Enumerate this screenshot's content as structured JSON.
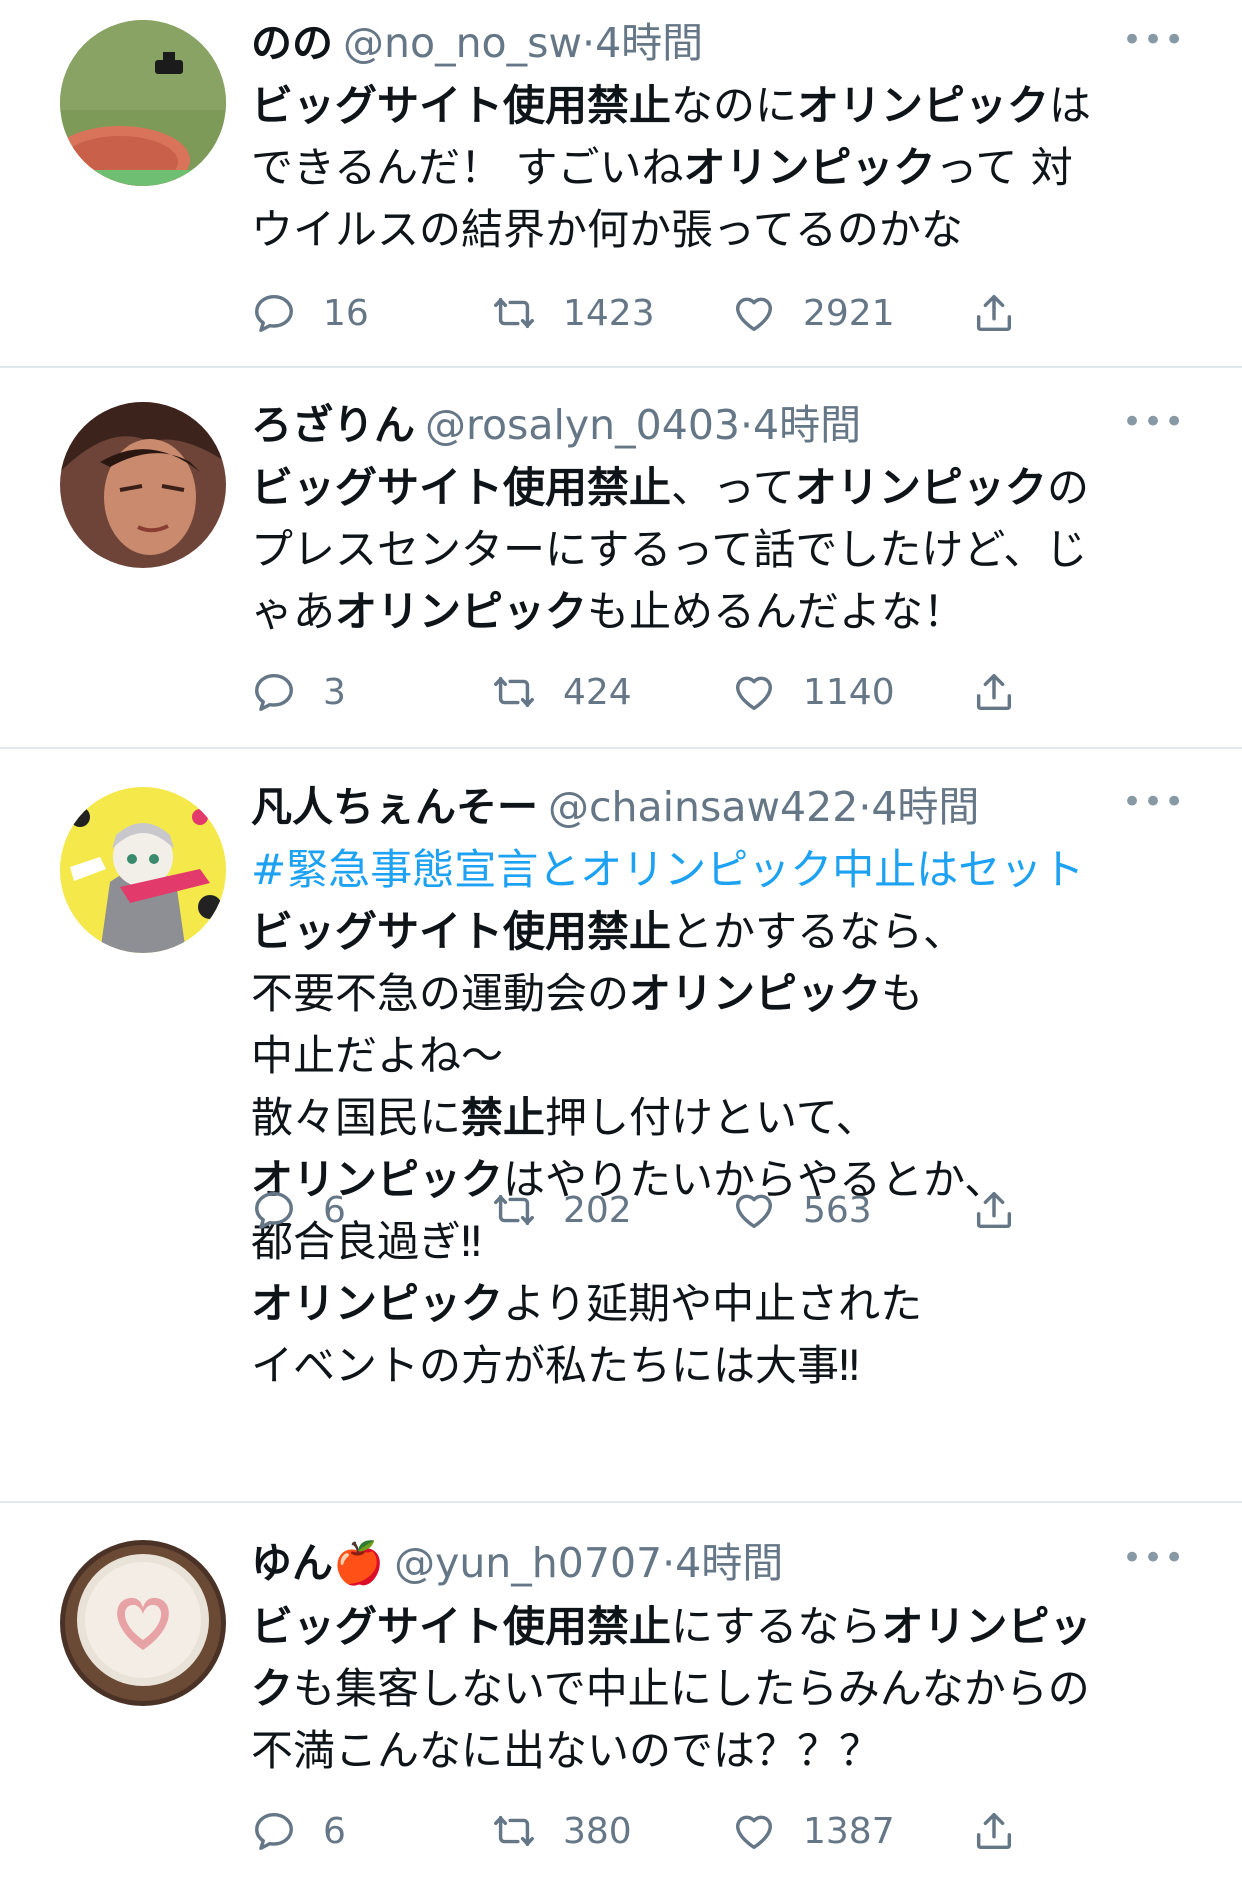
{
  "tweets": [
    {
      "name": "のの",
      "handle": "@no_no_sw",
      "time": "·4時間",
      "more": "•••",
      "hashtag": "",
      "segments": [
        {
          "t": "ビッグサイト使用禁止",
          "b": true
        },
        {
          "t": "なのに",
          "b": false
        },
        {
          "t": "オリンピック",
          "b": true
        },
        {
          "t": "は",
          "b": false
        },
        {
          "br": true
        },
        {
          "t": "できるんだ！ すごいね",
          "b": false
        },
        {
          "t": "オリンピック",
          "b": true
        },
        {
          "t": "って 対",
          "b": false
        },
        {
          "br": true
        },
        {
          "t": "ウイルスの結界か何か張ってるのかな",
          "b": false
        }
      ],
      "replies": "16",
      "retweets": "1423",
      "likes": "2921"
    },
    {
      "name": "ろざりん",
      "handle": "@rosalyn_0403",
      "time": "·4時間",
      "more": "•••",
      "hashtag": "",
      "segments": [
        {
          "t": "ビッグサイト使用禁止",
          "b": true
        },
        {
          "t": "、って",
          "b": false
        },
        {
          "t": "オリンピック",
          "b": true
        },
        {
          "t": "の",
          "b": false
        },
        {
          "br": true
        },
        {
          "t": "プレスセンターにするって話でしたけど、じ",
          "b": false
        },
        {
          "br": true
        },
        {
          "t": "ゃあ",
          "b": false
        },
        {
          "t": "オリンピック",
          "b": true
        },
        {
          "t": "も止めるんだよな！",
          "b": false
        }
      ],
      "replies": "3",
      "retweets": "424",
      "likes": "1140"
    },
    {
      "name": "凡人ちぇんそー",
      "handle": "@chainsaw422",
      "time": "·4時間",
      "more": "•••",
      "hashtag": "#緊急事態宣言とオリンピック中止はセット",
      "segments": [
        {
          "t": "ビッグサイト使用禁止",
          "b": true
        },
        {
          "t": "とかするなら、",
          "b": false
        },
        {
          "br": true
        },
        {
          "t": "不要不急の運動会の",
          "b": false
        },
        {
          "t": "オリンピック",
          "b": true
        },
        {
          "t": "も",
          "b": false
        },
        {
          "br": true
        },
        {
          "t": "中止だよね〜",
          "b": false
        },
        {
          "br": true
        },
        {
          "t": "散々国民に",
          "b": false
        },
        {
          "t": "禁止",
          "b": true
        },
        {
          "t": "押し付けといて、",
          "b": false
        },
        {
          "br": true
        },
        {
          "t": "オリンピック",
          "b": true
        },
        {
          "t": "はやりたいからやるとか、",
          "b": false
        },
        {
          "br": true
        },
        {
          "t": "都合良過ぎ‼︎",
          "b": false
        },
        {
          "br": true
        },
        {
          "t": "オリンピック",
          "b": true
        },
        {
          "t": "より延期や中止された",
          "b": false
        },
        {
          "br": true
        },
        {
          "t": "イベントの方が私たちには大事‼︎",
          "b": false
        }
      ],
      "replies": "6",
      "retweets": "202",
      "likes": "563"
    },
    {
      "name": "ゆん🍎",
      "handle": "@yun_h0707",
      "time": "·4時間",
      "more": "•••",
      "hashtag": "",
      "segments": [
        {
          "t": "ビッグサイト使用禁止",
          "b": true
        },
        {
          "t": "にするなら",
          "b": false
        },
        {
          "t": "オリンピッ",
          "b": true
        },
        {
          "br": true
        },
        {
          "t": "ク",
          "b": true
        },
        {
          "t": "も集客しないで中止にしたらみんなからの",
          "b": false
        },
        {
          "br": true
        },
        {
          "t": "不満こんなに出ないのでは？？？",
          "b": false
        }
      ],
      "replies": "6",
      "retweets": "380",
      "likes": "1387"
    }
  ],
  "colors": {
    "text": "#0f1419",
    "secondary": "#657786",
    "hashtag": "#1da1f2",
    "separator": "#e1e8ed"
  }
}
